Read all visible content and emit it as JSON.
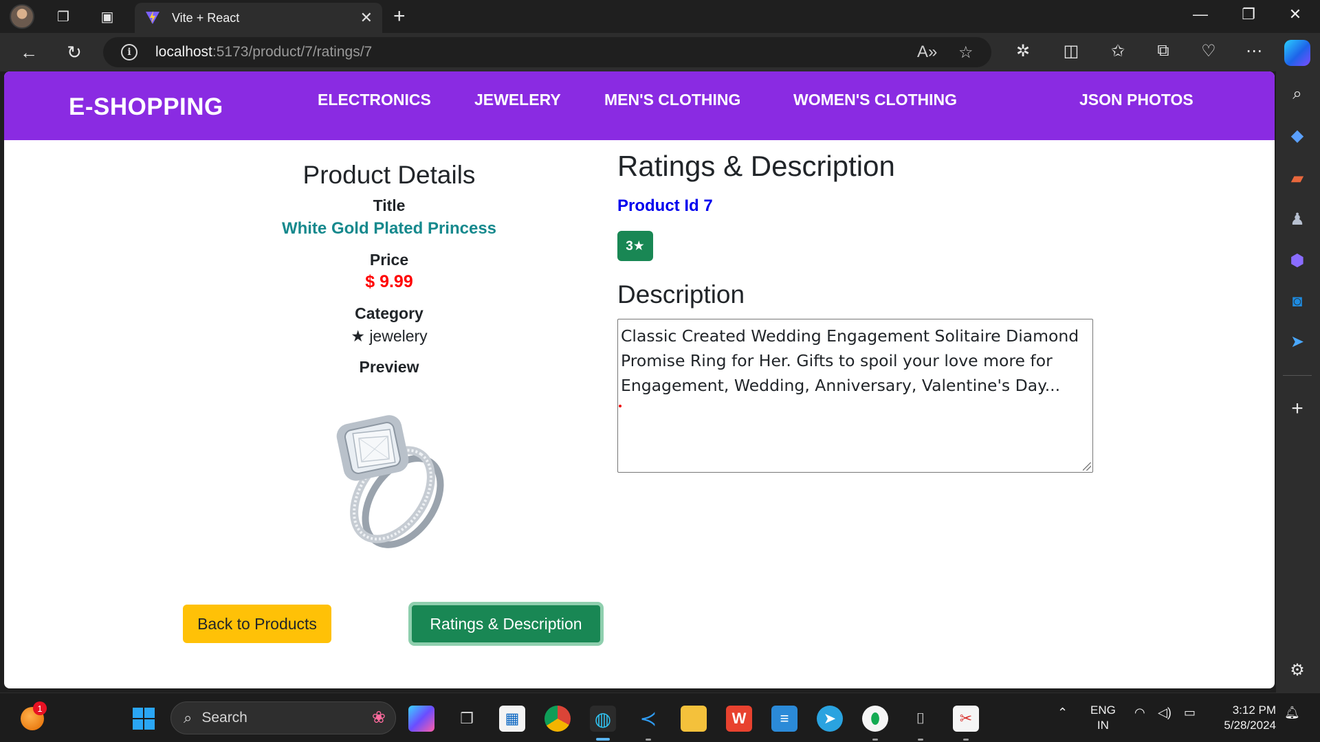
{
  "browser": {
    "tab_title": "Vite + React",
    "url_host": "localhost",
    "url_path": ":5173/product/7/ratings/7"
  },
  "navbar": {
    "brand": "E-SHOPPING",
    "links": [
      "ELECTRONICS",
      "JEWELERY",
      "MEN'S CLOTHING",
      "WOMEN'S CLOTHING",
      "JSON PHOTOS"
    ]
  },
  "details": {
    "heading": "Product Details",
    "title_label": "Title",
    "title_value": "White Gold Plated Princess",
    "price_label": "Price",
    "price_value": "$ 9.99",
    "category_label": "Category",
    "category_value": "★ jewelery",
    "preview_label": "Preview"
  },
  "buttons": {
    "back": "Back to Products",
    "ratings": "Ratings & Description"
  },
  "ratings": {
    "heading": "Ratings & Description",
    "product_id": "Product Id 7",
    "badge": "3★",
    "description_heading": "Description",
    "description_text": "Classic Created Wedding Engagement Solitaire Diamond Promise Ring for Her. Gifts to spoil your love more for Engagement, Wedding, Anniversary, Valentine's Day..."
  },
  "taskbar": {
    "search_placeholder": "Search",
    "notification_count": "1",
    "lang_line1": "ENG",
    "lang_line2": "IN",
    "time": "3:12 PM",
    "date": "5/28/2024"
  },
  "colors": {
    "navbar": "#8a2be2",
    "title_teal": "#16898d",
    "price_red": "#ff0000",
    "product_id_blue": "#0000ee",
    "badge_green": "#198754",
    "back_button_yellow": "#ffc107"
  }
}
